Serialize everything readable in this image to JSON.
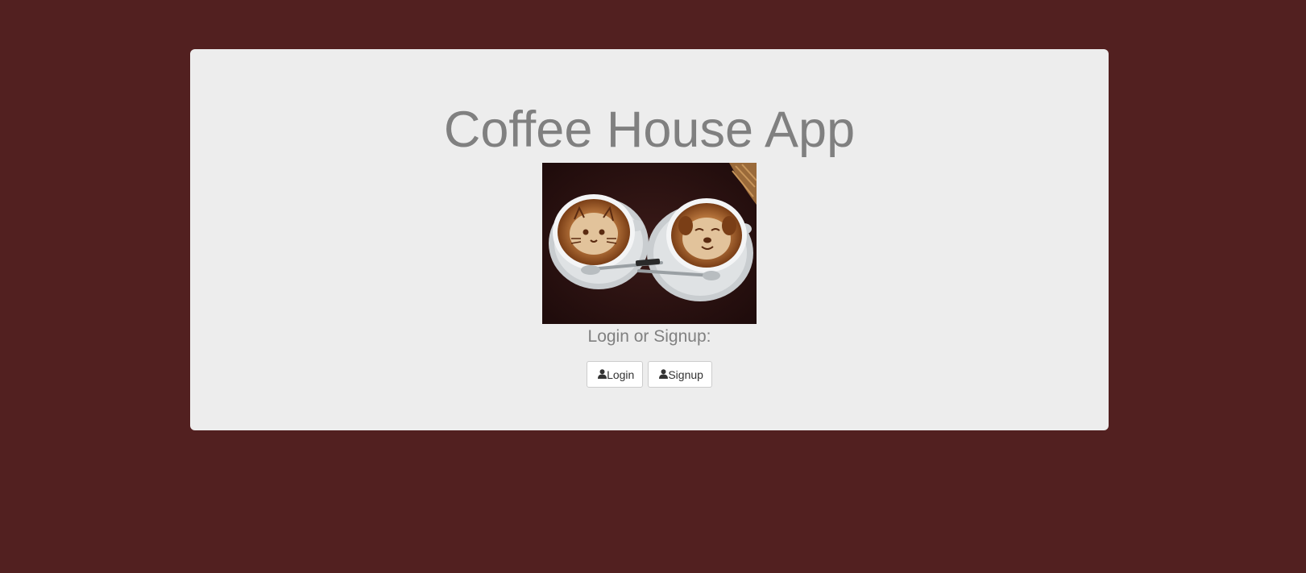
{
  "header": {
    "title": "Coffee House App"
  },
  "hero_image": {
    "description": "Two latte art coffee cups"
  },
  "auth": {
    "prompt": "Login or Signup:",
    "login_label": "Login",
    "signup_label": "Signup",
    "button_icon": "user-icon"
  },
  "colors": {
    "background": "#522020",
    "panel": "#ededed",
    "title_text": "#808080",
    "button_text": "#333333",
    "button_border": "#cccccc"
  }
}
